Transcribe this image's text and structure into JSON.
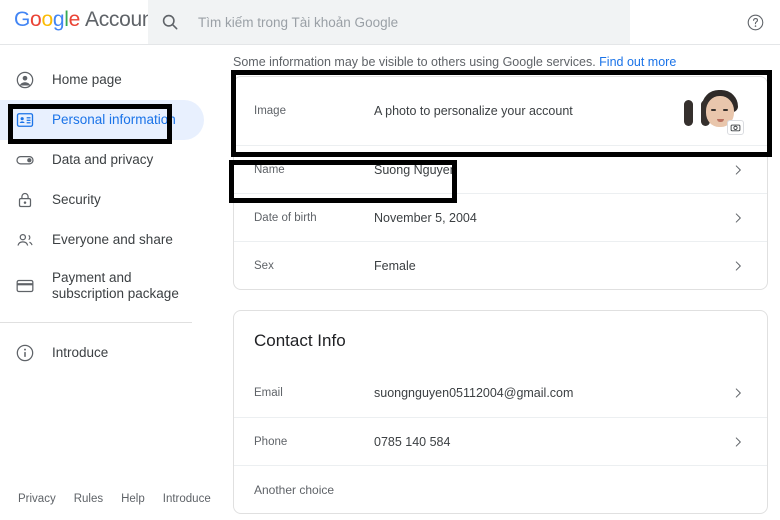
{
  "header": {
    "brand_google": "Google",
    "brand_product": "Account",
    "brand_letters": [
      "G",
      "o",
      "o",
      "g",
      "l",
      "e"
    ],
    "brand_colors": [
      "#4285f4",
      "#ea4335",
      "#fbbc05",
      "#4285f4",
      "#34a853",
      "#ea4335"
    ],
    "search_placeholder": "Tìm kiếm trong Tài khoản Google",
    "search_value": "",
    "search_icon": "search-icon",
    "help_icon": "help-circle-icon"
  },
  "sidebar": {
    "items": [
      {
        "label": "Home page",
        "icon": "account-circle-icon",
        "selected": false
      },
      {
        "label": "Personal information",
        "icon": "badge-id-card-icon",
        "selected": true
      },
      {
        "label": "Data and privacy",
        "icon": "toggle-switch-icon",
        "selected": false
      },
      {
        "label": "Security",
        "icon": "lock-icon",
        "selected": false
      },
      {
        "label": "Everyone and share",
        "icon": "people-icon",
        "selected": false
      },
      {
        "label": "Payment and subscription package",
        "icon": "credit-card-icon",
        "selected": false
      }
    ],
    "secondary": [
      {
        "label": "Introduce",
        "icon": "info-circle-icon",
        "selected": false
      }
    ],
    "footer_links": [
      "Privacy",
      "Rules",
      "Help",
      "Introduce"
    ]
  },
  "main": {
    "notice_text": "Some information may be visible to others using Google services.",
    "notice_link": "Find out more",
    "basic_info_rows": [
      {
        "key": "Image",
        "value": "A photo to personalize your account",
        "type": "avatar"
      },
      {
        "key": "Name",
        "value": "Suong Nguyen",
        "type": "chevron"
      },
      {
        "key": "Date of birth",
        "value": "November 5, 2004",
        "type": "chevron"
      },
      {
        "key": "Sex",
        "value": "Female",
        "type": "chevron"
      }
    ],
    "contact": {
      "title": "Contact Info",
      "rows": [
        {
          "key": "Email",
          "value": "suongnguyen05112004@gmail.com",
          "type": "chevron"
        },
        {
          "key": "Phone",
          "value": "0785 140 584",
          "type": "chevron"
        }
      ],
      "another_choice": "Another choice"
    }
  },
  "colors": {
    "accent_blue": "#1a73e8",
    "selected_bg": "#e8f0fe",
    "text_primary": "#3c4043",
    "text_secondary": "#5f6368",
    "search_bg": "#f1f3f4",
    "annotation": "#000000"
  }
}
